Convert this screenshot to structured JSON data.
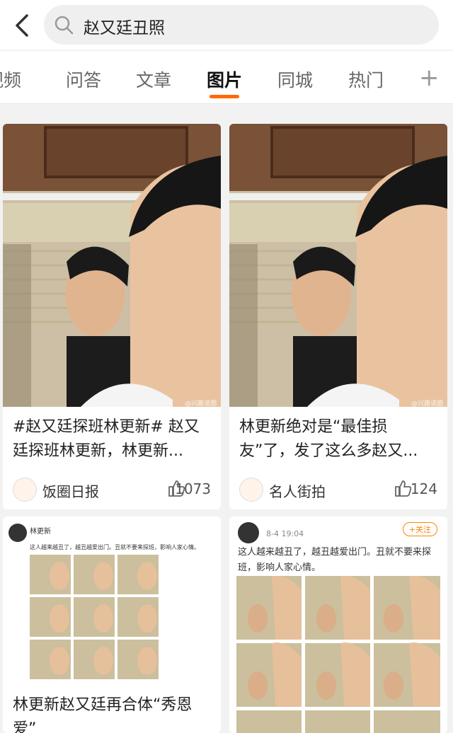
{
  "search": {
    "query": "赵又廷丑照"
  },
  "tabs": [
    {
      "label": "视频"
    },
    {
      "label": "问答"
    },
    {
      "label": "文章"
    },
    {
      "label": "图片"
    },
    {
      "label": "同城"
    },
    {
      "label": "热门"
    }
  ],
  "colors": {
    "accent": "#ff6a00"
  },
  "cards": [
    {
      "caption": "#赵又廷探班林更新# 赵又廷探班林更新，林更新...",
      "source": "饭圈日报",
      "likes": "1073"
    },
    {
      "caption": "林更新绝对是“最佳损友”了，发了这么多赵又...",
      "source": "名人街拍",
      "likes": "124"
    },
    {
      "caption": "林更新赵又廷再合体“秀恩爱”",
      "post_name": "林更新",
      "post_text": "这人越来越丑了，越丑越爱出门。丑就不要来探班，影响人家心情。"
    },
    {
      "post_time": "8-4 19:04",
      "post_follow": "+关注",
      "post_text": "这人越来越丑了，越丑越爱出门。丑就不要来探班，影响人家心情。"
    }
  ]
}
